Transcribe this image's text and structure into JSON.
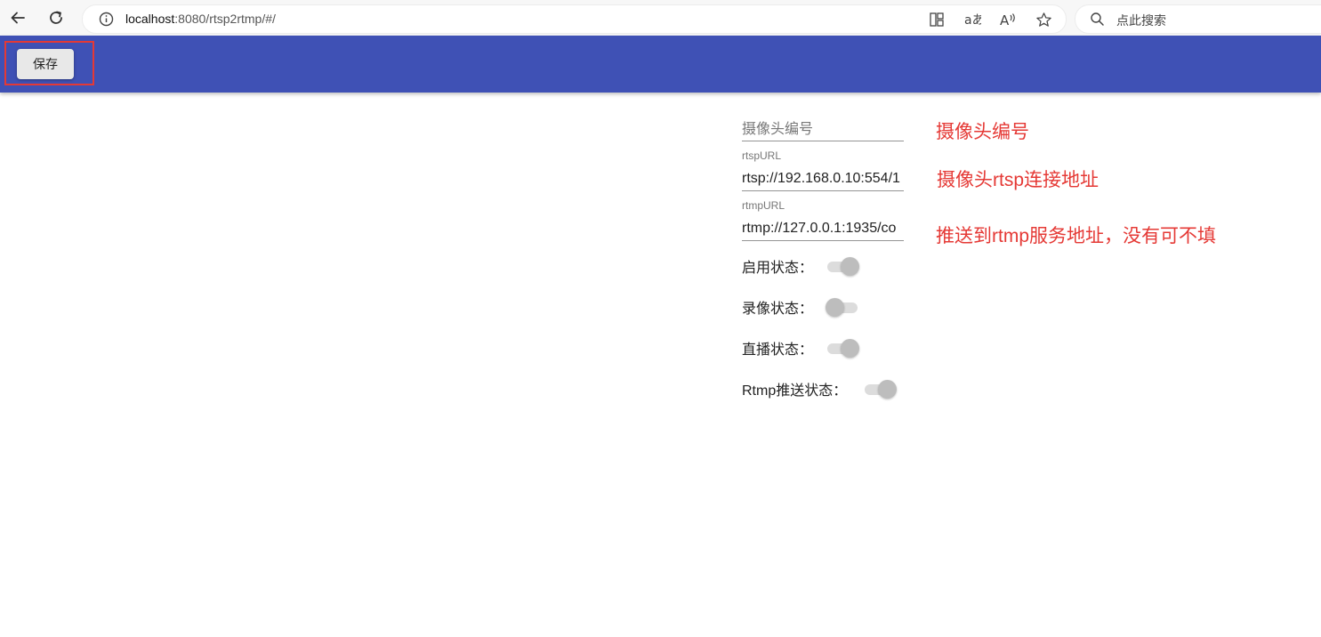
{
  "browser": {
    "url_host": "localhost",
    "url_rest": ":8080/rtsp2rtmp/#/",
    "search_placeholder": "点此搜索",
    "icons": [
      "back-icon",
      "refresh-icon",
      "info-icon",
      "split-screen-icon",
      "translate-icon",
      "read-aloud-icon",
      "favorite-star-icon",
      "search-icon"
    ]
  },
  "toolbar": {
    "save_label": "保存",
    "background_color": "#3f51b5"
  },
  "form": {
    "camera_code": {
      "placeholder": "摄像头编号",
      "value": ""
    },
    "rtsp_url": {
      "label": "rtspURL",
      "value": "rtsp://192.168.0.10:554/1"
    },
    "rtmp_url": {
      "label": "rtmpURL",
      "value": "rtmp://127.0.0.1:1935/co"
    },
    "toggles": [
      {
        "label": "启用状态：",
        "on": true
      },
      {
        "label": "录像状态：",
        "on": false
      },
      {
        "label": "直播状态：",
        "on": true
      },
      {
        "label": "Rtmp推送状态：",
        "on": true
      }
    ]
  },
  "annotations": {
    "camera_code_note": "摄像头编号",
    "rtsp_note": "摄像头rtsp连接地址",
    "rtmp_note": "推送到rtmp服务地址，没有可不填",
    "color": "#e53935"
  }
}
